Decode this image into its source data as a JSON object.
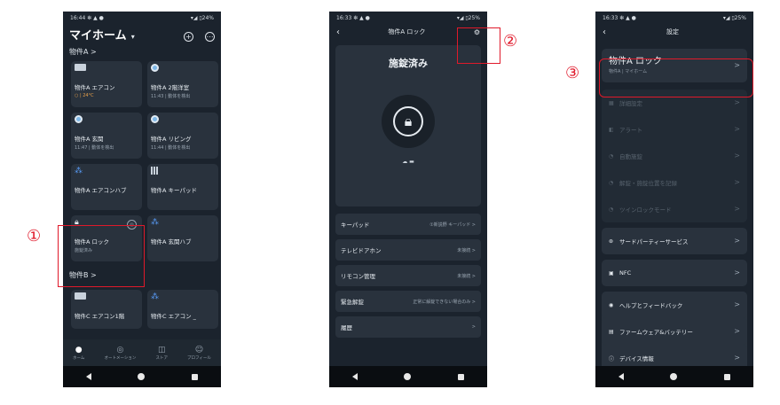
{
  "phone1": {
    "status_time": "16:44",
    "status_icons": "✻ ▲ ●",
    "status_right": "▾◢ ▯24%",
    "title": "マイホーム",
    "title_caret": "▾",
    "add_icon": "+",
    "more_icon": "⋯",
    "property_a_header": "物件A  >",
    "devices": [
      {
        "name": "物件A  エアコン",
        "status": "○ | 24°C",
        "icon": "ac-icon"
      },
      {
        "name": "物件A  2階洋室",
        "status": "11:43 | 動体を検出",
        "icon": "camera-icon"
      },
      {
        "name": "物件A  玄関",
        "status": "11:47 | 動体を検出",
        "icon": "camera-icon"
      },
      {
        "name": "物件A  リビング",
        "status": "11:44 | 動体を検出",
        "icon": "camera-icon"
      },
      {
        "name": "物件A  エアコンハブ",
        "status": "",
        "icon": "hub-icon"
      },
      {
        "name": "物件A  キーパッド",
        "status": "",
        "icon": "keypad-icon"
      },
      {
        "name": "物件A  ロック",
        "status": "施錠済み",
        "icon": "lock-icon"
      },
      {
        "name": "物件A  玄関ハブ",
        "status": "",
        "icon": "hub-icon"
      }
    ],
    "property_b_header": "物件B  >",
    "devices_b": [
      {
        "name": "物件C  エアコン1階",
        "icon": "ac-icon"
      },
      {
        "name": "物件C  エアコン _",
        "icon": "hub-icon"
      }
    ],
    "tabs": [
      "ホーム",
      "オートメーション",
      "ストア",
      "プロフィール"
    ]
  },
  "phone2": {
    "status_time": "16:33",
    "status_icons": "✻ ▲ ●",
    "status_right": "▾◢ ▯25%",
    "title": "物件A ロック",
    "back_icon": "‹",
    "settings_icon": "⚙",
    "lock_status": "施錠済み",
    "mini_icons": "☁  ▬",
    "rows": [
      {
        "label": "キーパッド",
        "value": "①新説野 キーパッド >"
      },
      {
        "label": "テレビドアホン",
        "value": "未接続 >"
      },
      {
        "label": "リモコン管理",
        "value": "未接続 >"
      },
      {
        "label": "緊急解錠",
        "value": "正常に解錠できない場合のみ >"
      },
      {
        "label": "履歴",
        "value": ">"
      }
    ]
  },
  "phone3": {
    "status_time": "16:33",
    "status_icons": "✻ ▲ ●",
    "status_right": "▾◢ ▯25%",
    "title": "設定",
    "back_icon": "‹",
    "device_name": "物件A  ロック",
    "device_sub": "物件A | マイホーム",
    "disabled_items": [
      "詳細設定",
      "アラート",
      "自動施錠",
      "解錠・施錠位置を記録",
      "ツインロックモード"
    ],
    "third_party": "サードパーティーサービス",
    "nfc": "NFC",
    "help": "ヘルプとフィードバック",
    "firmware": "ファームウェア&バッテリー",
    "device_info": "デバイス情報",
    "chevron": ">"
  },
  "annotations": {
    "one": "①",
    "two": "②",
    "three": "③",
    "color": "#e0192a"
  }
}
